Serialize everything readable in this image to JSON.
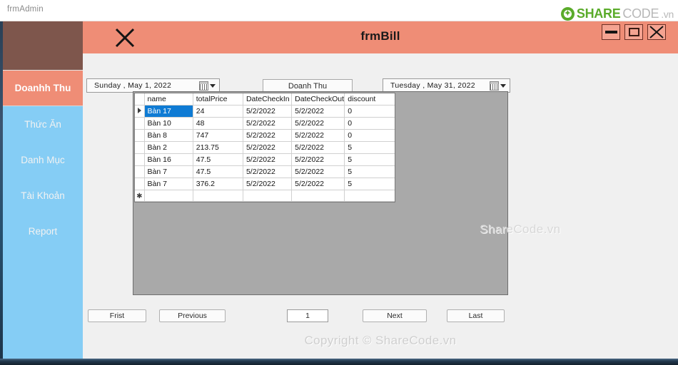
{
  "titlebar": {
    "label": "frmAdmin"
  },
  "brand": {
    "icon": "sharecode-leaf-icon",
    "share": "SHARE",
    "code": "CODE",
    "vn": ".vn"
  },
  "sidebar": {
    "items": [
      {
        "label": "Doanhh Thu",
        "active": true
      },
      {
        "label": "Thức Ăn",
        "active": false
      },
      {
        "label": "Danh Mục",
        "active": false
      },
      {
        "label": "Tài Khoản",
        "active": false
      },
      {
        "label": "Report",
        "active": false
      }
    ]
  },
  "form": {
    "title": "frmBill",
    "close_icon": "close-x-icon",
    "window_controls": [
      {
        "name": "minimize-button",
        "icon": "minimize-icon"
      },
      {
        "name": "maximize-button",
        "icon": "maximize-icon"
      },
      {
        "name": "close-button",
        "icon": "close-icon"
      }
    ]
  },
  "filters": {
    "date_from": "Sunday    ,    May        1, 2022",
    "date_to": "Tuesday   ,    May       31, 2022",
    "calendar_icon": "calendar-icon",
    "dropdown_icon": "chevron-down-icon",
    "report_button": "Doanh Thu"
  },
  "grid": {
    "columns": [
      "name",
      "totalPrice",
      "DateCheckIn",
      "DateCheckOut",
      "discount"
    ],
    "rows": [
      {
        "selected": true,
        "marker": "current-row-arrow",
        "name": "Bàn 17",
        "totalPrice": "24",
        "DateCheckIn": "5/2/2022",
        "DateCheckOut": "5/2/2022",
        "discount": "0"
      },
      {
        "selected": false,
        "marker": "",
        "name": "Bàn 10",
        "totalPrice": "48",
        "DateCheckIn": "5/2/2022",
        "DateCheckOut": "5/2/2022",
        "discount": "0"
      },
      {
        "selected": false,
        "marker": "",
        "name": "Bàn 8",
        "totalPrice": "747",
        "DateCheckIn": "5/2/2022",
        "DateCheckOut": "5/2/2022",
        "discount": "0"
      },
      {
        "selected": false,
        "marker": "",
        "name": "Bàn 2",
        "totalPrice": "213.75",
        "DateCheckIn": "5/2/2022",
        "DateCheckOut": "5/2/2022",
        "discount": "5"
      },
      {
        "selected": false,
        "marker": "",
        "name": "Bàn 16",
        "totalPrice": "47.5",
        "DateCheckIn": "5/2/2022",
        "DateCheckOut": "5/2/2022",
        "discount": "5"
      },
      {
        "selected": false,
        "marker": "",
        "name": "Bàn 7",
        "totalPrice": "47.5",
        "DateCheckIn": "5/2/2022",
        "DateCheckOut": "5/2/2022",
        "discount": "5"
      },
      {
        "selected": false,
        "marker": "",
        "name": "Bàn 7",
        "totalPrice": "376.2",
        "DateCheckIn": "5/2/2022",
        "DateCheckOut": "5/2/2022",
        "discount": "5"
      },
      {
        "selected": false,
        "marker": "new-row-star",
        "name": "",
        "totalPrice": "",
        "DateCheckIn": "",
        "DateCheckOut": "",
        "discount": ""
      }
    ]
  },
  "pager": {
    "first": "Frist",
    "previous": "Previous",
    "current_page": "1",
    "next": "Next",
    "last": "Last"
  },
  "watermarks": {
    "panel": "ShareCode.vn",
    "footer": "Copyright © ShareCode.vn"
  },
  "colors": {
    "accent_salmon": "#ef8d76",
    "sidebar_blue": "#85cdf5",
    "sidebar_brown": "#7e564c",
    "grid_selection": "#0f7bd4",
    "panel_gray": "#a9a9a9",
    "brand_green": "#5aab2a"
  }
}
